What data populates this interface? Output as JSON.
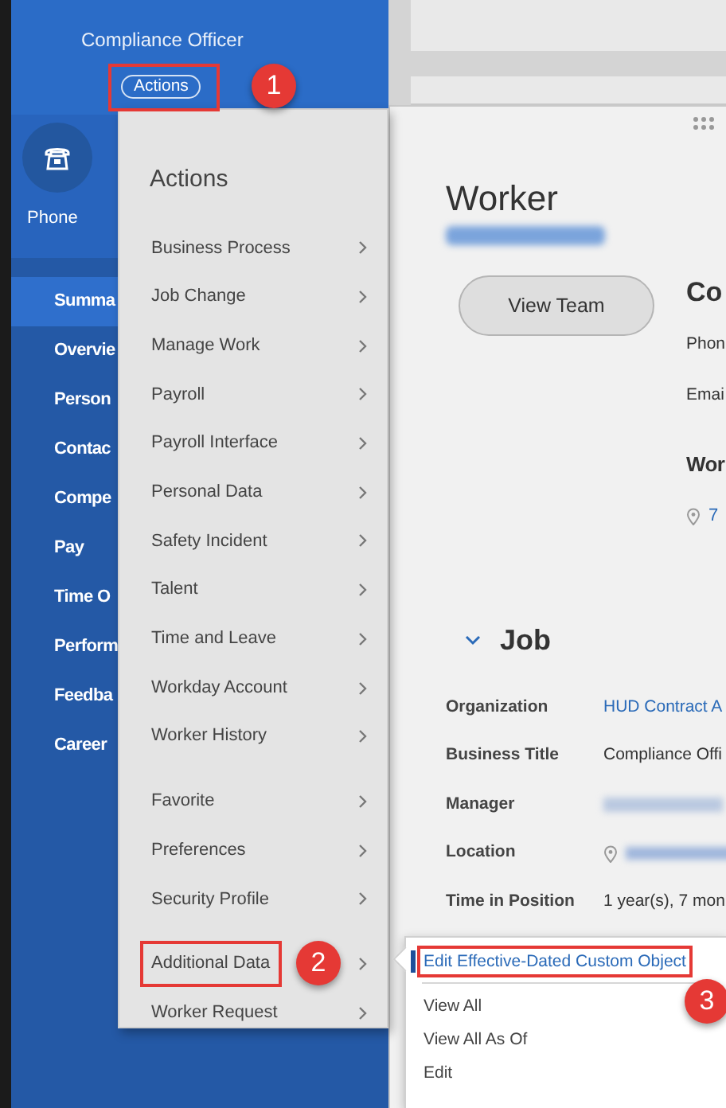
{
  "header": {
    "role": "Compliance Officer",
    "actions_button": "Actions",
    "callout": "1"
  },
  "sidebar": {
    "phone_label": "Phone",
    "items": [
      {
        "label": "Summa",
        "selected": true
      },
      {
        "label": "Overvie",
        "selected": false
      },
      {
        "label": "Person",
        "selected": false
      },
      {
        "label": "Contac",
        "selected": false
      },
      {
        "label": "Compe",
        "selected": false
      },
      {
        "label": "Pay",
        "selected": false
      },
      {
        "label": "Time O",
        "selected": false
      },
      {
        "label": "Perform",
        "selected": false
      },
      {
        "label": "Feedba",
        "selected": false
      },
      {
        "label": "Career",
        "selected": false
      }
    ]
  },
  "actions_menu": {
    "title": "Actions",
    "groups": [
      [
        {
          "label": "Business Process",
          "highlighted": false
        },
        {
          "label": "Job Change",
          "highlighted": false
        },
        {
          "label": "Manage Work",
          "highlighted": false
        },
        {
          "label": "Payroll",
          "highlighted": false
        },
        {
          "label": "Payroll Interface",
          "highlighted": false
        },
        {
          "label": "Personal Data",
          "highlighted": false
        },
        {
          "label": "Safety Incident",
          "highlighted": false
        },
        {
          "label": "Talent",
          "highlighted": false
        },
        {
          "label": "Time and Leave",
          "highlighted": false
        },
        {
          "label": "Workday Account",
          "highlighted": false
        },
        {
          "label": "Worker History",
          "highlighted": false
        }
      ],
      [
        {
          "label": "Favorite",
          "highlighted": false
        },
        {
          "label": "Preferences",
          "highlighted": false
        },
        {
          "label": "Security Profile",
          "highlighted": false
        }
      ],
      [
        {
          "label": "Additional Data",
          "highlighted": true,
          "callout": "2"
        },
        {
          "label": "Worker Request",
          "highlighted": false
        }
      ]
    ]
  },
  "submenu": {
    "groups": [
      [
        {
          "label": "Edit Effective-Dated Custom Object",
          "selected": true,
          "highlighted": true,
          "callout": "3"
        }
      ],
      [
        {
          "label": "View All",
          "selected": false,
          "highlighted": false
        },
        {
          "label": "View All As Of",
          "selected": false,
          "highlighted": false
        },
        {
          "label": "Edit",
          "selected": false,
          "highlighted": false
        }
      ]
    ]
  },
  "worker": {
    "title": "Worker",
    "view_team": "View Team"
  },
  "contact": {
    "heading": "Co",
    "fields": [
      "Phon",
      "Emai"
    ],
    "work_heading": "Wor",
    "address": "7"
  },
  "job": {
    "heading": "Job",
    "expanded": true,
    "rows": [
      {
        "label": "Organization",
        "kind": "link",
        "value": "HUD Contract A"
      },
      {
        "label": "Business Title",
        "kind": "text",
        "value": "Compliance Offi"
      },
      {
        "label": "Manager",
        "kind": "blurred"
      },
      {
        "label": "Location",
        "kind": "blurred_location"
      },
      {
        "label": "Time in Position",
        "kind": "text",
        "value": "1 year(s), 7 mon"
      }
    ]
  }
}
